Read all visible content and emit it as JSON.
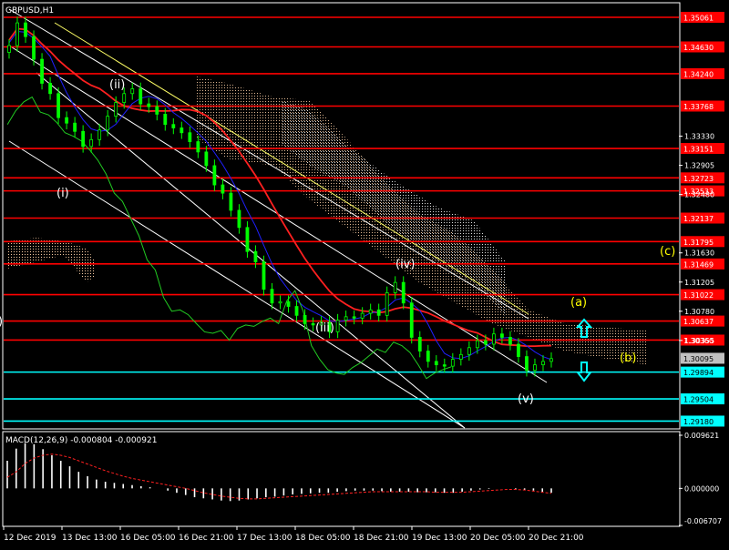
{
  "window": {
    "symbol_label": "GBPUSD,H1",
    "macd_label": "MACD(12,26,9) -0.000804 -0.000921"
  },
  "colors": {
    "background": "#000000",
    "grid": "#ffffff",
    "candle": "#00ff00",
    "resistance": "#ff0000",
    "support": "#00ffff",
    "ma_red": "#ff2020",
    "ma_blue": "#2020ff",
    "chikou": "#22cc22",
    "cloud": "#f5c9a0",
    "channel": "#ffffff",
    "yellow_line": "#ffff66",
    "wave_white": "#ffffff",
    "wave_yellow": "#ffff00",
    "arrow": "#00ffff",
    "macd_hist": "#ffffff",
    "macd_signal": "#ff2020"
  },
  "chart_data": {
    "type": "candlestick",
    "symbol": "GBPUSD",
    "timeframe": "H1",
    "ylim": [
      1.2908,
      1.3526
    ],
    "x_ticks": [
      "12 Dec 2019",
      "13 Dec 13:00",
      "16 Dec 05:00",
      "16 Dec 21:00",
      "17 Dec 13:00",
      "18 Dec 05:00",
      "18 Dec 21:00",
      "19 Dec 13:00",
      "20 Dec 05:00",
      "20 Dec 21:00"
    ],
    "y_ticks_plain": [
      "1.33330",
      "1.32905",
      "1.32480",
      "1.31630",
      "1.31205",
      "1.30780",
      "1.30355"
    ],
    "current_price": "1.30095",
    "current_price_value": 1.30095,
    "resistance_levels": [
      {
        "label": "1.35061",
        "value": 1.35061
      },
      {
        "label": "1.34630",
        "value": 1.3463
      },
      {
        "label": "1.34240",
        "value": 1.3424
      },
      {
        "label": "1.33768",
        "value": 1.33768
      },
      {
        "label": "1.33151",
        "value": 1.33151
      },
      {
        "label": "1.32723",
        "value": 1.32723
      },
      {
        "label": "1.32533",
        "value": 1.32533
      },
      {
        "label": "1.32137",
        "value": 1.32137
      },
      {
        "label": "1.31795",
        "value": 1.31795
      },
      {
        "label": "1.31469",
        "value": 1.31469
      },
      {
        "label": "1.31022",
        "value": 1.31022
      },
      {
        "label": "1.30637",
        "value": 1.30637
      },
      {
        "label": "1.30360",
        "value": 1.3036
      }
    ],
    "support_levels": [
      {
        "label": "1.29894",
        "value": 1.29894
      },
      {
        "label": "1.29504",
        "value": 1.29504
      },
      {
        "label": "1.29180",
        "value": 1.2918
      }
    ],
    "wave_labels": [
      {
        "text": "(i)",
        "color": "white"
      },
      {
        "text": "(ii)",
        "color": "white"
      },
      {
        "text": "(iii)",
        "color": "white"
      },
      {
        "text": "(iv)",
        "color": "white"
      },
      {
        "text": "(v)",
        "color": "white"
      },
      {
        "text": "(a)",
        "color": "yellow"
      },
      {
        "text": "(b)",
        "color": "yellow"
      },
      {
        "text": "(c)",
        "color": "yellow"
      }
    ],
    "arrows": [
      {
        "direction": "up",
        "color": "cyan"
      },
      {
        "direction": "down",
        "color": "cyan"
      }
    ],
    "close_series": [
      1.3465,
      1.3498,
      1.3478,
      1.3445,
      1.341,
      1.3395,
      1.336,
      1.3352,
      1.334,
      1.3318,
      1.3328,
      1.3342,
      1.3362,
      1.3382,
      1.3395,
      1.3402,
      1.338,
      1.3376,
      1.3365,
      1.335,
      1.3345,
      1.3338,
      1.3325,
      1.331,
      1.329,
      1.3262,
      1.325,
      1.3225,
      1.32,
      1.3165,
      1.315,
      1.311,
      1.309,
      1.3092,
      1.3085,
      1.3072,
      1.306,
      1.3058,
      1.3062,
      1.3048,
      1.3065,
      1.307,
      1.3068,
      1.3075,
      1.308,
      1.3072,
      1.3105,
      1.312,
      1.309,
      1.304,
      1.302,
      1.3005,
      1.3,
      1.2998,
      1.3008,
      1.3015,
      1.3025,
      1.3035,
      1.303,
      1.3045,
      1.304,
      1.303,
      1.3012,
      1.2992,
      1.3,
      1.3005,
      1.3009
    ],
    "macd": {
      "label": "MACD(12,26,9)",
      "main": "-0.000804",
      "signal": "-0.000921",
      "y_ticks": [
        "0.009621",
        "0.000000",
        "-0.006707"
      ],
      "ylim": [
        -0.006707,
        0.009621
      ],
      "hist": [
        0.005,
        0.0072,
        0.0082,
        0.008,
        0.0071,
        0.006,
        0.005,
        0.004,
        0.003,
        0.0022,
        0.0016,
        0.0012,
        0.001,
        0.0008,
        0.0006,
        0.0004,
        0.0002,
        0.0,
        -0.0004,
        -0.0008,
        -0.0012,
        -0.0016,
        -0.0018,
        -0.002,
        -0.0022,
        -0.0023,
        -0.0022,
        -0.002,
        -0.0018,
        -0.0016,
        -0.0015,
        -0.0013,
        -0.0011,
        -0.001,
        -0.0009,
        -0.0008,
        -0.0008,
        -0.0006,
        -0.0005,
        -0.0004,
        -0.0004,
        -0.0004,
        -0.0005,
        -0.0006,
        -0.0006,
        -0.0006,
        -0.0007,
        -0.0007,
        -0.0007,
        -0.0008,
        -0.0008,
        -0.0006,
        -0.0004,
        -0.0002,
        -0.0001,
        0.0,
        0.0,
        -0.0002,
        -0.0003,
        -0.0004,
        -0.0006,
        -0.0008
      ],
      "signal_series": [
        0.002,
        0.003,
        0.0045,
        0.0055,
        0.006,
        0.0062,
        0.006,
        0.0056,
        0.005,
        0.0044,
        0.0038,
        0.0032,
        0.0027,
        0.0022,
        0.0018,
        0.0015,
        0.0012,
        0.0009,
        0.0006,
        0.0003,
        0.0,
        -0.0004,
        -0.0008,
        -0.0011,
        -0.0014,
        -0.0016,
        -0.0018,
        -0.0019,
        -0.0019,
        -0.0018,
        -0.0017,
        -0.0016,
        -0.0015,
        -0.0014,
        -0.0013,
        -0.0012,
        -0.0011,
        -0.001,
        -0.0009,
        -0.0008,
        -0.0007,
        -0.0006,
        -0.0006,
        -0.0006,
        -0.0006,
        -0.0006,
        -0.0006,
        -0.0006,
        -0.0007,
        -0.0007,
        -0.0007,
        -0.0007,
        -0.0006,
        -0.0005,
        -0.0004,
        -0.0003,
        -0.0002,
        -0.0002,
        -0.0003,
        -0.0005,
        -0.0007,
        -0.0009
      ]
    }
  }
}
